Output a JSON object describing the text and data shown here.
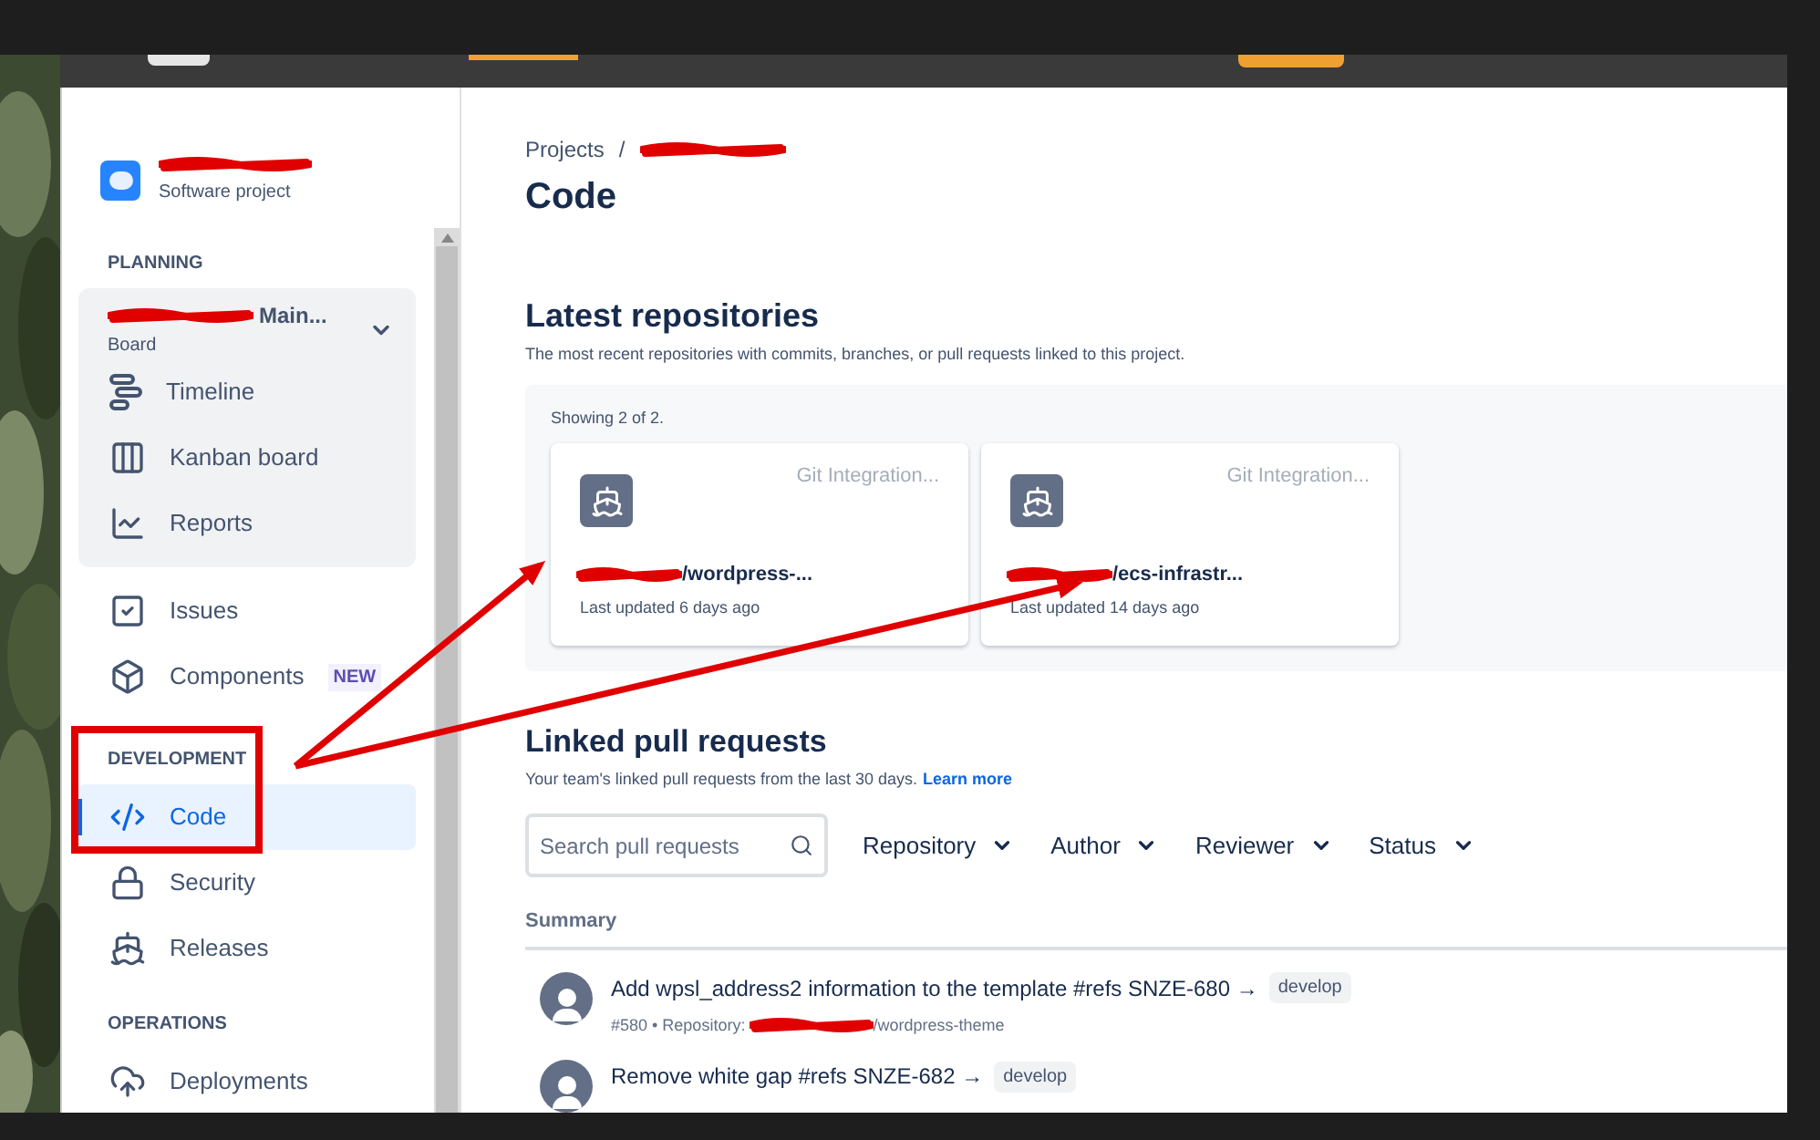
{
  "project": {
    "type": "Software project"
  },
  "sidebar": {
    "sections": [
      {
        "heading": "PLANNING",
        "board": {
          "name": "Main...",
          "type": "Board",
          "expanded": true
        },
        "items": [
          {
            "label": "Timeline",
            "selected": false
          },
          {
            "label": "Kanban board",
            "selected": false
          },
          {
            "label": "Reports",
            "selected": false
          }
        ]
      },
      {
        "items": [
          {
            "label": "Issues",
            "selected": false
          },
          {
            "label": "Components",
            "selected": false,
            "badge": "NEW"
          }
        ]
      },
      {
        "heading": "DEVELOPMENT",
        "items": [
          {
            "label": "Code",
            "selected": true
          },
          {
            "label": "Security",
            "selected": false
          },
          {
            "label": "Releases",
            "selected": false
          }
        ]
      },
      {
        "heading": "OPERATIONS",
        "items": [
          {
            "label": "Deployments",
            "selected": false
          }
        ]
      }
    ]
  },
  "breadcrumb": [
    "Projects",
    "/"
  ],
  "title": "Code",
  "repositories": {
    "title": "Latest repositories",
    "description": "The most recent repositories with commits, branches, or pull requests linked to this project.",
    "count": "Showing 2 of 2.",
    "items": [
      {
        "provider": "Git Integration...",
        "name": "/wordpress-...",
        "updated": "Last updated 6 days ago"
      },
      {
        "provider": "Git Integration...",
        "name": "/ecs-infrastr...",
        "updated": "Last updated 14 days ago"
      }
    ]
  },
  "pull_requests": {
    "title": "Linked pull requests",
    "description": "Your team's linked pull requests from the last 30 days.",
    "link": "Learn more",
    "search": {
      "placeholder": "Search pull requests"
    },
    "filters": [
      "Repository",
      "Author",
      "Reviewer",
      "Status"
    ],
    "column": "Summary",
    "rows": [
      {
        "title": "Add wpsl_address2 information to the template #refs SNZE-680 →",
        "branch": "develop",
        "meta": "#580 • Repository:",
        "repo": "/wordpress-theme"
      },
      {
        "title": "Remove white gap #refs SNZE-682 →",
        "branch": "develop"
      }
    ]
  }
}
